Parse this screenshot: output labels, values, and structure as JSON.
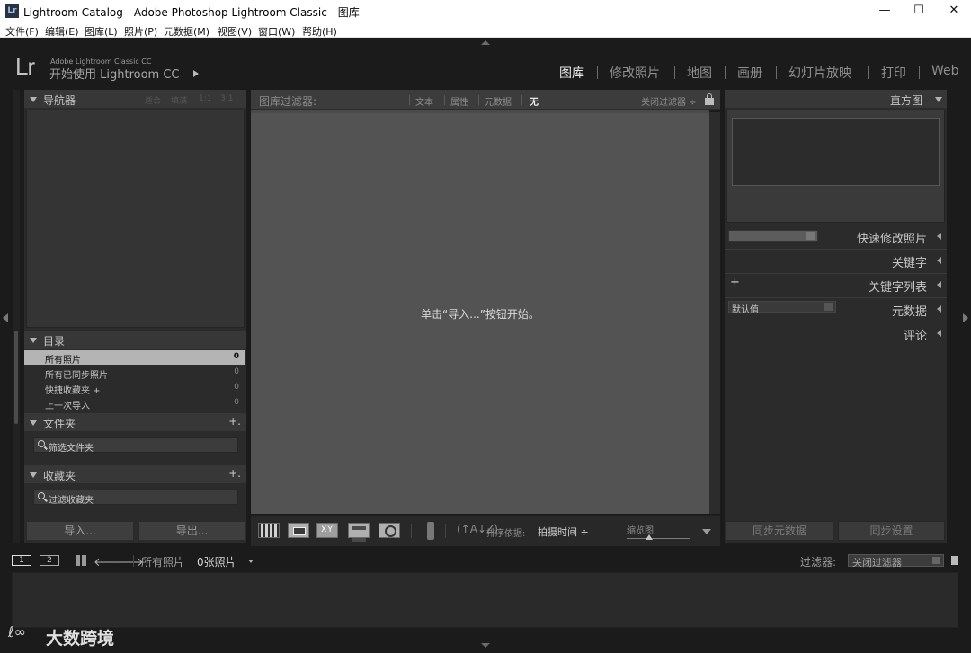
{
  "window": {
    "title": "Lightroom Catalog - Adobe Photoshop Lightroom Classic - 图库",
    "app_icon": "Lr",
    "minimize": "—",
    "maximize": "☐",
    "close": "✕"
  },
  "menu": [
    "文件(F)",
    "编辑(E)",
    "图库(L)",
    "照片(P)",
    "元数据(M)",
    "视图(V)",
    "窗口(W)",
    "帮助(H)"
  ],
  "identity": {
    "logo": "Lr",
    "product_small": "Adobe Lightroom Classic CC",
    "product_big": "开始使用 Lightroom CC"
  },
  "modules": [
    {
      "label": "图库",
      "active": true
    },
    {
      "label": "修改照片",
      "active": false
    },
    {
      "label": "地图",
      "active": false
    },
    {
      "label": "画册",
      "active": false
    },
    {
      "label": "幻灯片放映",
      "active": false
    },
    {
      "label": "打印",
      "active": false
    },
    {
      "label": "Web",
      "active": false
    }
  ],
  "left": {
    "navigator": {
      "title": "导航器",
      "zoom_options": [
        "适合",
        "填满",
        "1:1",
        "3:1"
      ]
    },
    "catalog": {
      "title": "目录",
      "items": [
        {
          "label": "所有照片",
          "count": "0"
        },
        {
          "label": "所有已同步照片",
          "count": "0"
        },
        {
          "label": "快捷收藏夹 +",
          "count": "0"
        },
        {
          "label": "上一次导入",
          "count": "0"
        }
      ]
    },
    "folders": {
      "title": "文件夹",
      "add": "+.",
      "search": "筛选文件夹"
    },
    "collections": {
      "title": "收藏夹",
      "add": "+.",
      "search": "过滤收藏夹"
    },
    "import_label": "导入...",
    "export_label": "导出..."
  },
  "filter_bar": {
    "title": "图库过滤器:",
    "options": [
      {
        "label": "文本",
        "active": false
      },
      {
        "label": "属性",
        "active": false
      },
      {
        "label": "元数据",
        "active": false
      },
      {
        "label": "无",
        "active": true
      }
    ],
    "close": "关闭过滤器 ÷"
  },
  "grid": {
    "message": "单击“导入...”按钮开始。"
  },
  "toolbar": {
    "compare_label": "XY",
    "sort_icon": "(↑A↓Z)",
    "sort_label": "排序依据:",
    "sort_value": "拍摄时间 ÷",
    "thumbnail_label": "缩览图",
    "thumbnail_size": 0.35
  },
  "right": {
    "histogram_title": "直方图",
    "panels": [
      {
        "title": "快速修改照片"
      },
      {
        "title": "关键字"
      },
      {
        "title": "关键字列表"
      },
      {
        "title": "元数据"
      },
      {
        "title": "评论"
      }
    ],
    "keyword_add": "+",
    "metadata_preset": "默认值",
    "sync_metadata": "同步元数据",
    "sync_settings": "同步设置"
  },
  "filmstrip": {
    "screen1": "1",
    "screen2": "2",
    "back_arrow": "🡐",
    "forward_arrow": "🡒",
    "source": "所有照片",
    "count": "0张照片",
    "filter_label": "过滤器:",
    "filter_value": "关闭过滤器"
  },
  "watermark": {
    "mark": "ℓ∞",
    "text": "大数跨境"
  }
}
